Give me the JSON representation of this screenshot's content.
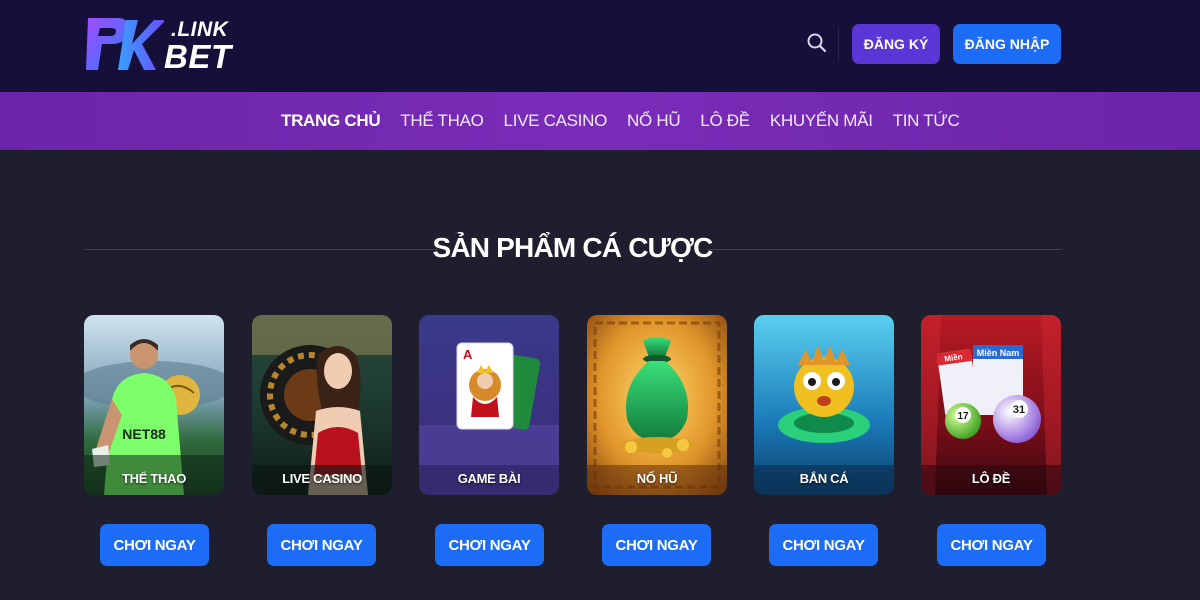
{
  "header": {
    "logo": {
      "link_text": ".LINK",
      "bet_text": "BET",
      "mark": "PK"
    },
    "search_icon": "search-icon",
    "register_label": "ĐĂNG KÝ",
    "login_label": "ĐĂNG NHẬP"
  },
  "nav": {
    "items": [
      {
        "label": "TRANG CHỦ"
      },
      {
        "label": "THỂ THAO"
      },
      {
        "label": "LIVE CASINO"
      },
      {
        "label": "NỔ HŨ"
      },
      {
        "label": "LÔ ĐỀ"
      },
      {
        "label": "KHUYẾN MÃI"
      },
      {
        "label": "TIN TỨC"
      }
    ]
  },
  "products": {
    "title": "SẢN PHẨM CÁ CƯỢC",
    "items": [
      {
        "label": "THỂ THAO",
        "jersey_text": "NET88",
        "button": "CHƠI NGAY"
      },
      {
        "label": "LIVE CASINO",
        "button": "CHƠI NGAY"
      },
      {
        "label": "GAME BÀI",
        "button": "CHƠI NGAY"
      },
      {
        "label": "NỔ HŨ",
        "button": "CHƠI NGAY"
      },
      {
        "label": "BẮN CÁ",
        "button": "CHƠI NGAY"
      },
      {
        "label": "LÔ ĐỀ",
        "ticket_text": "Miền Nam",
        "ticket2_text": "Miền",
        "ball1": "17",
        "ball2": "31",
        "button": "CHƠI NGAY"
      }
    ]
  },
  "colors": {
    "header_bg": "#150f3a",
    "nav_bg": "#6b25a8",
    "page_bg": "#1e1e2e",
    "primary_button": "#1d6cf5",
    "register_button": "#5a36d6"
  }
}
